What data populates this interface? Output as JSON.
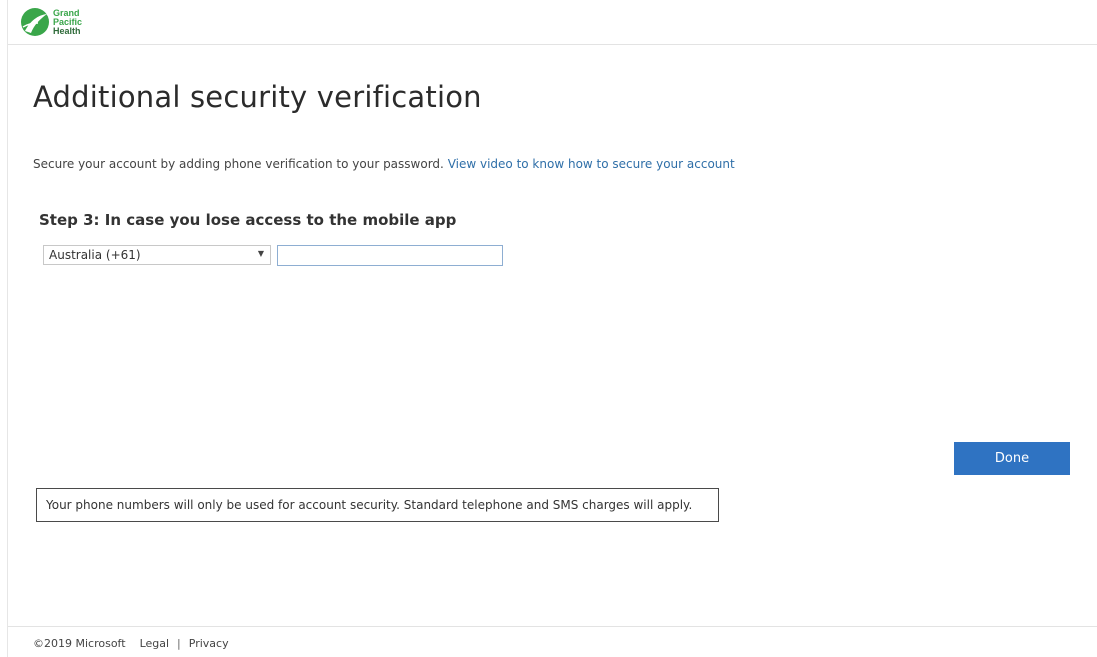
{
  "brand": {
    "logo_icon": "grand-pacific-health-logo",
    "logo_line1": "Grand",
    "logo_line2": "Pacific",
    "logo_line3": "Health",
    "colors": {
      "logo_green": "#3aa64a",
      "logo_dark_green": "#2f6b3a"
    }
  },
  "main": {
    "title": "Additional security verification",
    "intro_text": "Secure your account by adding phone verification to your password.",
    "intro_link": "View video to know how to secure your account",
    "step_heading": "Step 3: In case you lose access to the mobile app",
    "country_select": {
      "selected": "Australia (+61)",
      "caret_icon": "dropdown-triangle-icon"
    },
    "phone_input": {
      "value": "",
      "placeholder": ""
    },
    "done_label": "Done",
    "notice": "Your phone numbers will only be used for account security. Standard telephone and SMS charges will apply."
  },
  "footer": {
    "copyright": "©2019 Microsoft",
    "legal": "Legal",
    "separator": "|",
    "privacy": "Privacy"
  },
  "colors": {
    "accent_button": "#2f73c2",
    "link": "#2f6fa8"
  }
}
